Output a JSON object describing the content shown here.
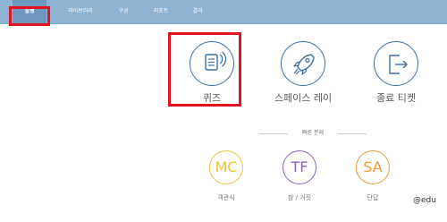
{
  "nav": {
    "items": [
      "실행",
      "라이브러리",
      "구성",
      "리포트",
      "결과"
    ],
    "active_index": 0
  },
  "main_buttons": [
    {
      "label": "퀴즈",
      "icon": "quiz-icon"
    },
    {
      "label": "스페이스 레이",
      "icon": "rocket-icon"
    },
    {
      "label": "종료 티켓",
      "icon": "exit-ticket-icon"
    }
  ],
  "quick_question": {
    "title": "빠른 문제",
    "items": [
      {
        "code": "MC",
        "label": "객관식",
        "color": "#e8c43a"
      },
      {
        "code": "TF",
        "label": "참 / 거짓",
        "color": "#8a63b8"
      },
      {
        "code": "SA",
        "label": "단답",
        "color": "#e89a3c"
      }
    ]
  },
  "brand": "@edu",
  "colors": {
    "topbar": "#8fb3d2",
    "active_tab": "#6f96bb",
    "icon_blue": "#3d6fa4",
    "highlight": "#e0141e"
  }
}
